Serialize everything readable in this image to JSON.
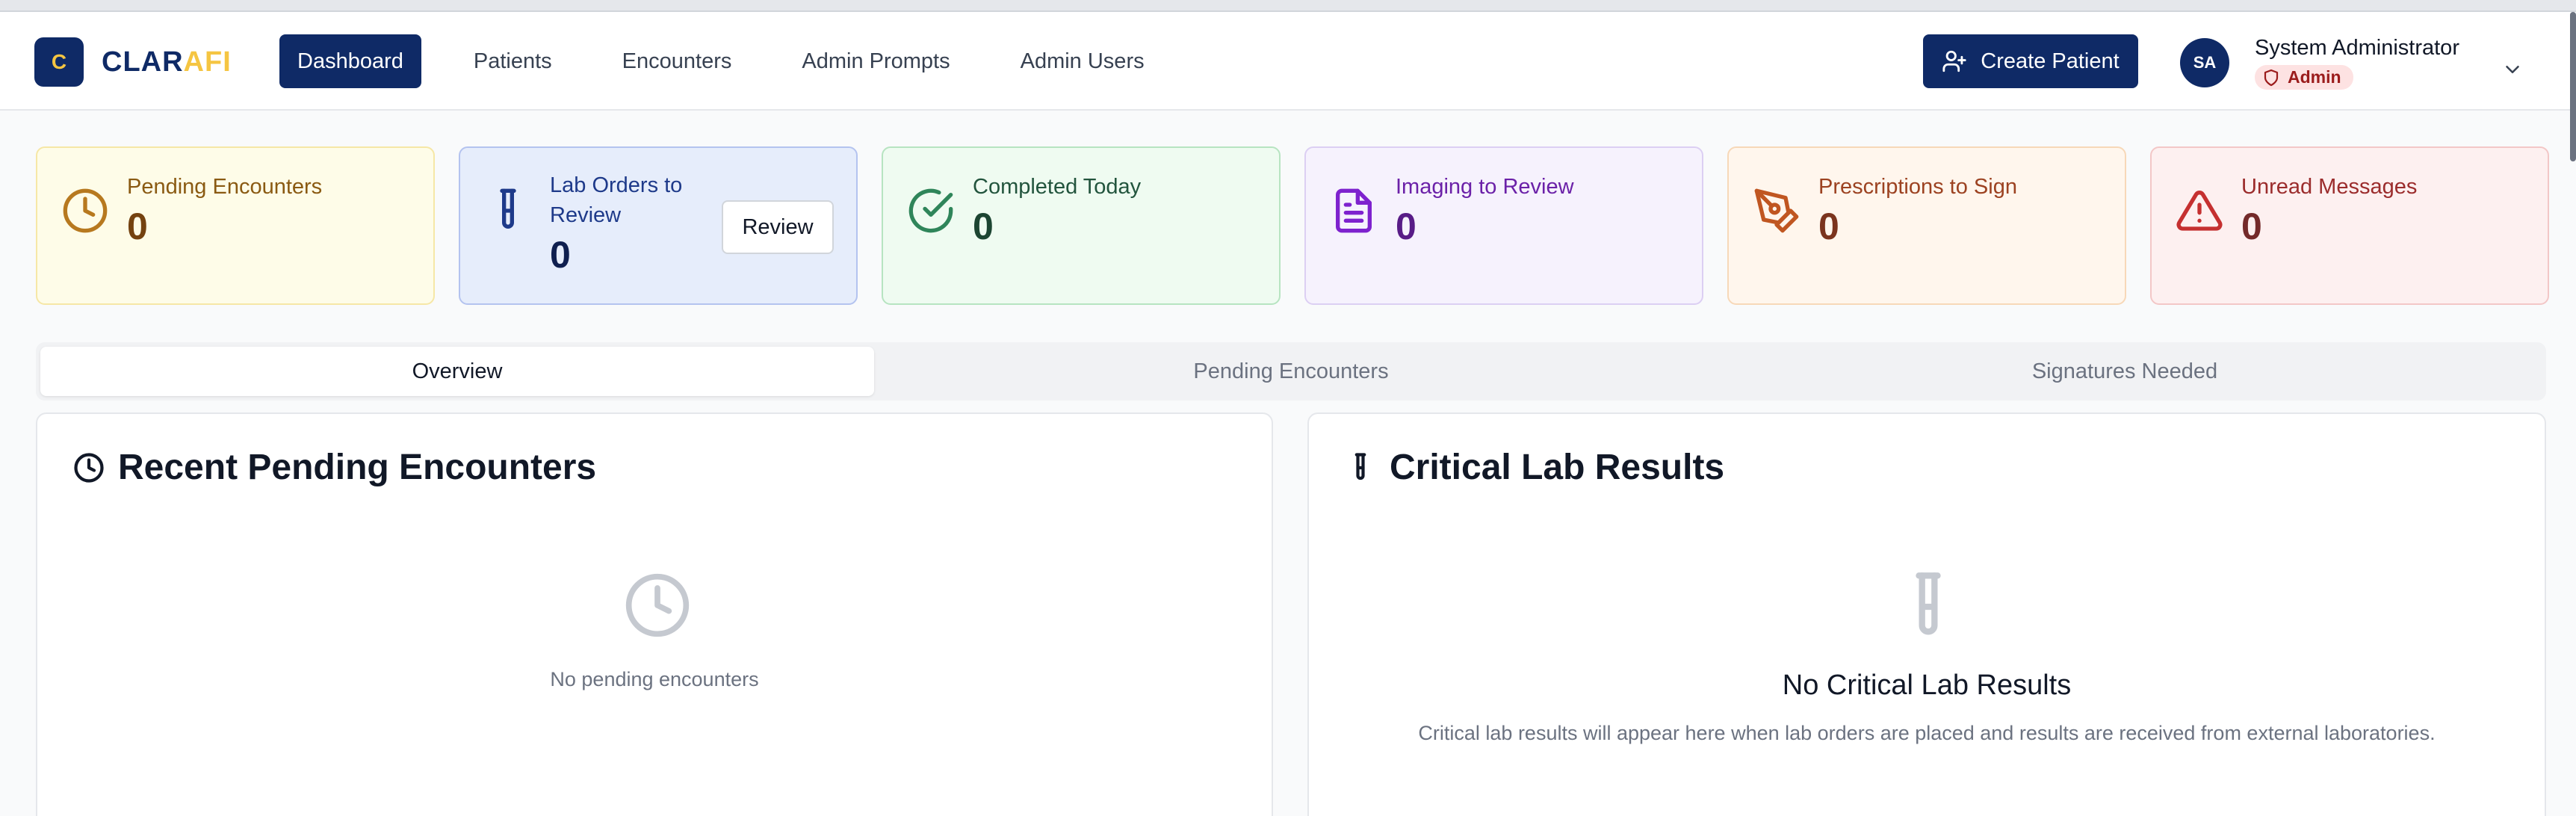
{
  "app": {
    "logo_letter": "C",
    "logo_part1": "CLAR",
    "logo_part2": "AFI"
  },
  "nav": [
    {
      "label": "Dashboard",
      "active": true
    },
    {
      "label": "Patients"
    },
    {
      "label": "Encounters"
    },
    {
      "label": "Admin Prompts"
    },
    {
      "label": "Admin Users"
    }
  ],
  "header": {
    "create_button": "Create Patient",
    "user_initials": "SA",
    "user_name": "System Administrator",
    "user_role": "Admin"
  },
  "stats": [
    {
      "label": "Pending Encounters",
      "value": "0",
      "icon": "clock-icon",
      "color": "#b7791f"
    },
    {
      "label": "Lab Orders to Review",
      "value": "0",
      "icon": "test-tube-icon",
      "color": "#1e3a8a",
      "action": "Review"
    },
    {
      "label": "Completed Today",
      "value": "0",
      "icon": "check-circle-icon",
      "color": "#2f855a"
    },
    {
      "label": "Imaging to Review",
      "value": "0",
      "icon": "file-text-icon",
      "color": "#6b21a8"
    },
    {
      "label": "Prescriptions to Sign",
      "value": "0",
      "icon": "pen-icon",
      "color": "#c05621"
    },
    {
      "label": "Unread Messages",
      "value": "0",
      "icon": "alert-triangle-icon",
      "color": "#c53030"
    }
  ],
  "tabs": [
    {
      "label": "Overview",
      "active": true
    },
    {
      "label": "Pending Encounters"
    },
    {
      "label": "Signatures Needed"
    }
  ],
  "panels": {
    "pending": {
      "title": "Recent Pending Encounters",
      "empty_text": "No pending encounters"
    },
    "labs": {
      "title": "Critical Lab Results",
      "empty_title": "No Critical Lab Results",
      "empty_text": "Critical lab results will appear here when lab orders are placed and results are received from external laboratories."
    }
  }
}
